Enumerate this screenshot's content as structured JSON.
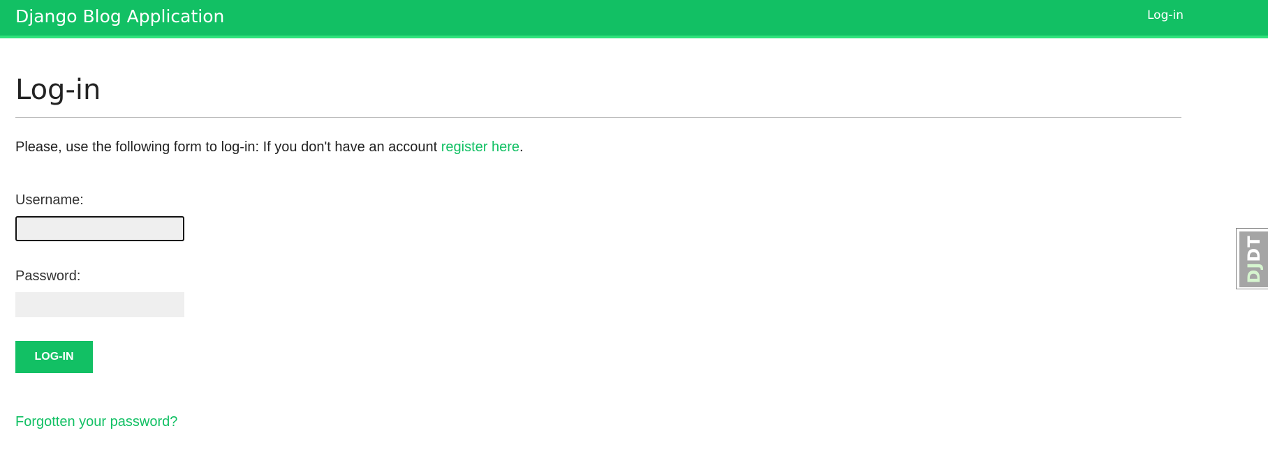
{
  "header": {
    "brand": "Django Blog Application",
    "nav_login": "Log-in",
    "colors": {
      "background": "#12c064",
      "border": "#2ee37b"
    }
  },
  "main": {
    "title": "Log-in",
    "intro_text": "Please, use the following form to log-in: If you don't have an account ",
    "register_link": "register here",
    "intro_end": ".",
    "form": {
      "username_label": "Username:",
      "username_value": "",
      "password_label": "Password:",
      "password_value": "",
      "submit_label": "Log-in"
    },
    "forgot_link": "Forgotten your password?",
    "accent_color": "#12c064"
  },
  "debug_toolbar": {
    "handle_dj": "DJ",
    "handle_dt": "DT"
  }
}
